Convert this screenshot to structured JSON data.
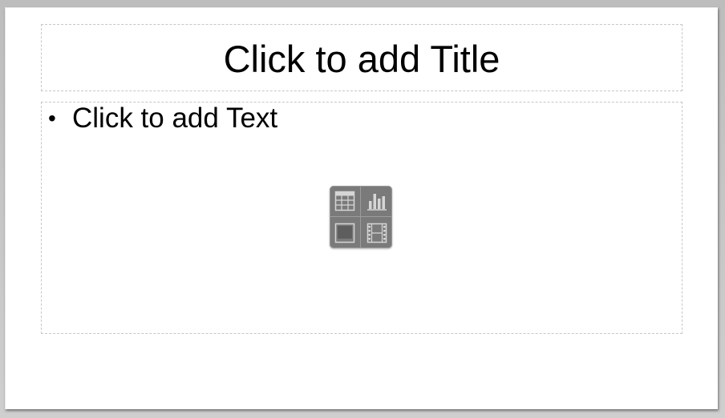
{
  "slide": {
    "title_placeholder": "Click to add Title",
    "content_placeholder": "Click to add Text",
    "bullet_glyph": "•"
  },
  "insert_panel": {
    "items": [
      {
        "icon": "table-icon"
      },
      {
        "icon": "chart-icon"
      },
      {
        "icon": "image-icon"
      },
      {
        "icon": "video-icon"
      }
    ],
    "icon_color": "#d6d6d6",
    "panel_color": "#7a7a7a"
  }
}
